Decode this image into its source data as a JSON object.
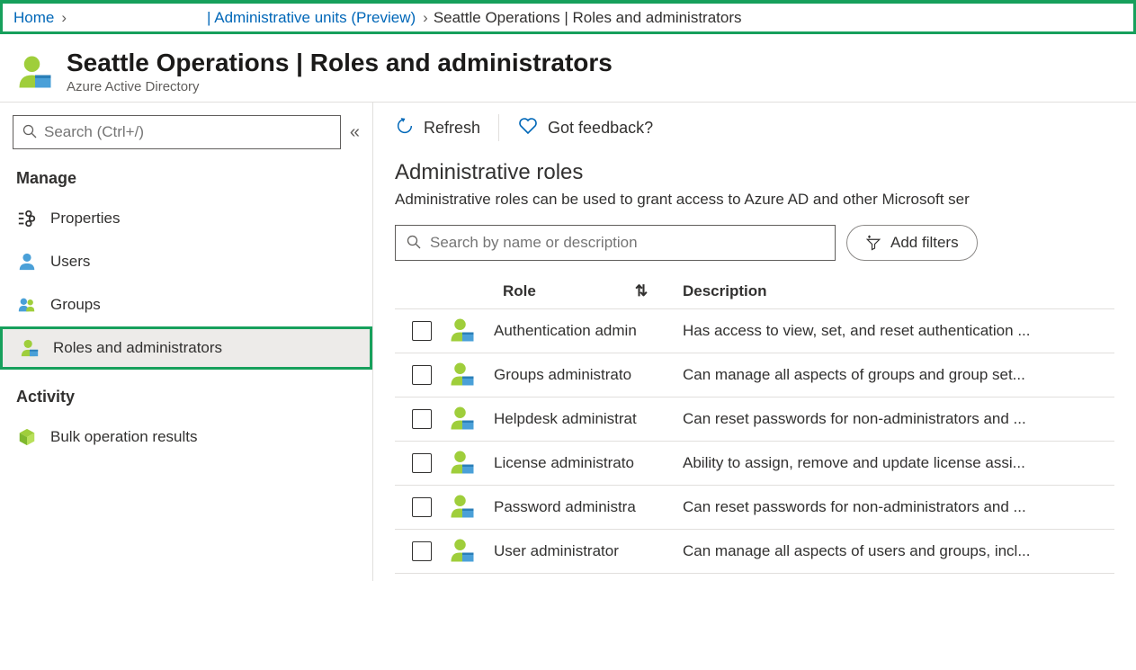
{
  "breadcrumb": {
    "home": "Home",
    "mid_prefix": "| ",
    "mid": "Administrative units (Preview)",
    "current": "Seattle Operations | Roles and administrators"
  },
  "header": {
    "title": "Seattle Operations | Roles and administrators",
    "subtitle": "Azure Active Directory"
  },
  "sidebar": {
    "search_placeholder": "Search (Ctrl+/)",
    "sections": {
      "manage": "Manage",
      "activity": "Activity"
    },
    "items": {
      "properties": "Properties",
      "users": "Users",
      "groups": "Groups",
      "roles": "Roles and administrators",
      "bulk": "Bulk operation results"
    }
  },
  "toolbar": {
    "refresh": "Refresh",
    "feedback": "Got feedback?"
  },
  "content": {
    "heading": "Administrative roles",
    "description": "Administrative roles can be used to grant access to Azure AD and other Microsoft ser",
    "search_placeholder": "Search by name or description",
    "add_filters": "Add filters",
    "col_role": "Role",
    "col_desc": "Description",
    "rows": [
      {
        "name": "Authentication admin",
        "desc": "Has access to view, set, and reset authentication ..."
      },
      {
        "name": "Groups administrato",
        "desc": "Can manage all aspects of groups and group set..."
      },
      {
        "name": "Helpdesk administrat",
        "desc": "Can reset passwords for non-administrators and ..."
      },
      {
        "name": "License administrato",
        "desc": "Ability to assign, remove and update license assi..."
      },
      {
        "name": "Password administra",
        "desc": "Can reset passwords for non-administrators and ..."
      },
      {
        "name": "User administrator",
        "desc": "Can manage all aspects of users and groups, incl..."
      }
    ]
  }
}
